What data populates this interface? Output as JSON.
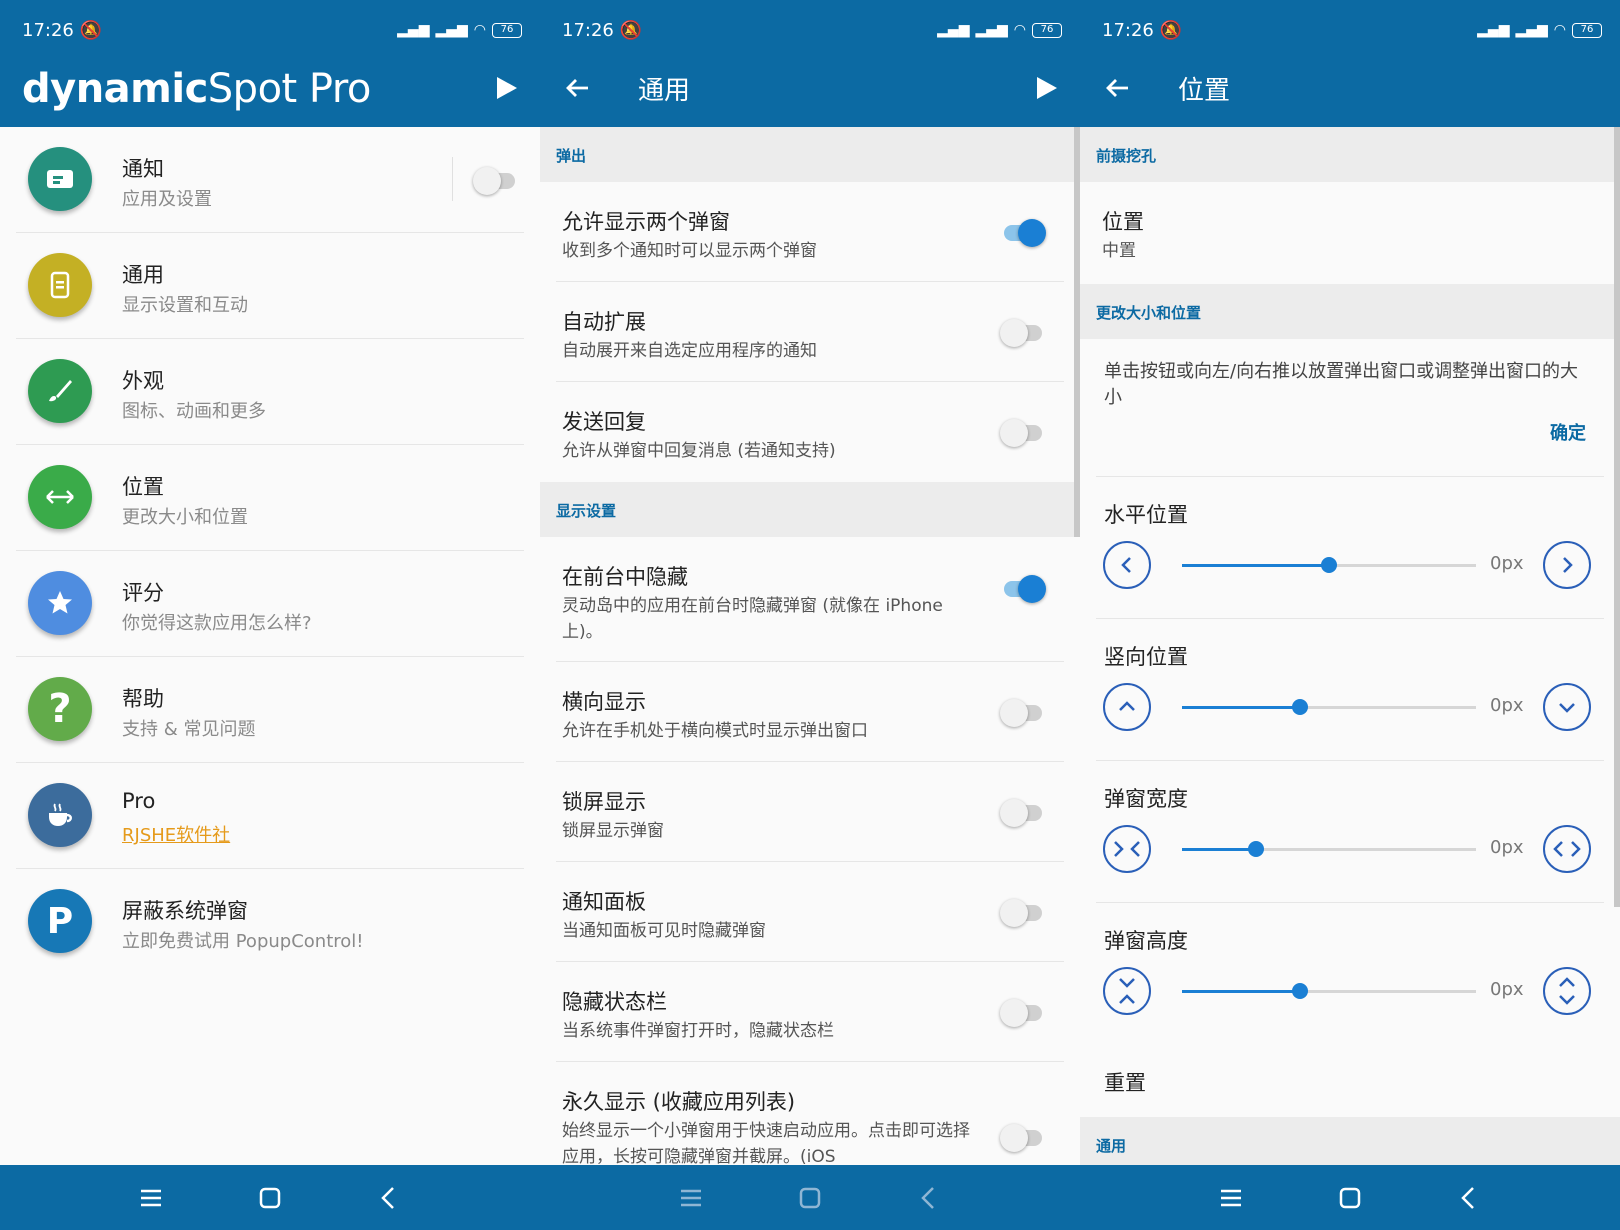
{
  "status": {
    "time": "17:26",
    "battery": "76"
  },
  "screen1": {
    "brand_bold": "dynamic",
    "brand_light": "Spot Pro",
    "items": [
      {
        "title": "通知",
        "subtitle": "应用及设置",
        "color": "#25907e",
        "icon": "notification-icon",
        "toggle": false
      },
      {
        "title": "通用",
        "subtitle": "显示设置和互动",
        "color": "#c4b024",
        "icon": "phone-icon"
      },
      {
        "title": "外观",
        "subtitle": "图标、动画和更多",
        "color": "#2e9b52",
        "icon": "brush-icon"
      },
      {
        "title": "位置",
        "subtitle": "更改大小和位置",
        "color": "#3aab49",
        "icon": "arrows-icon"
      },
      {
        "title": "评分",
        "subtitle": "你觉得这款应用怎么样?",
        "color": "#4f8de0",
        "icon": "star-icon"
      },
      {
        "title": "帮助",
        "subtitle": "支持 & 常见问题",
        "color": "#62ab4a",
        "icon": "help-icon"
      },
      {
        "title": "Pro",
        "subtitle": "RJSHE软件社",
        "color": "#3c6c9c",
        "icon": "coffee-icon"
      },
      {
        "title": "屏蔽系统弹窗",
        "subtitle": "立即免费试用 PopupControl!",
        "color": "#1778b6",
        "icon": "popupcontrol-icon"
      }
    ]
  },
  "screen2": {
    "title": "通用",
    "section1": "弹出",
    "rows1": [
      {
        "title": "允许显示两个弹窗",
        "subtitle": "收到多个通知时可以显示两个弹窗",
        "on": true
      },
      {
        "title": "自动扩展",
        "subtitle": "自动展开来自选定应用程序的通知",
        "on": false
      },
      {
        "title": "发送回复",
        "subtitle": "允许从弹窗中回复消息 (若通知支持)",
        "on": false
      }
    ],
    "section2": "显示设置",
    "rows2": [
      {
        "title": "在前台中隐藏",
        "subtitle": "灵动岛中的应用在前台时隐藏弹窗 (就像在 iPhone 上)。",
        "on": true
      },
      {
        "title": "横向显示",
        "subtitle": "允许在手机处于横向模式时显示弹出窗口",
        "on": false
      },
      {
        "title": "锁屏显示",
        "subtitle": "锁屏显示弹窗",
        "on": false
      },
      {
        "title": "通知面板",
        "subtitle": "当通知面板可见时隐藏弹窗",
        "on": false
      },
      {
        "title": "隐藏状态栏",
        "subtitle": "当系统事件弹窗打开时，隐藏状态栏",
        "on": false
      },
      {
        "title": "永久显示 (收藏应用列表)",
        "subtitle": "始终显示一个小弹窗用于快速启动应用。点击即可选择应用，长按可隐藏弹窗并截屏。(iOS",
        "on": false
      }
    ]
  },
  "screen3": {
    "title": "位置",
    "section1": "前摄挖孔",
    "position_label": "位置",
    "position_value": "中置",
    "section2": "更改大小和位置",
    "instructions": "单击按钮或向左/向右推以放置弹出窗口或调整弹出窗口的大小",
    "confirm": "确定",
    "sliders": [
      {
        "label": "水平位置",
        "value": "0px",
        "fraction": 0.5,
        "left_icon": "chevron-left-icon",
        "right_icon": "chevron-right-icon"
      },
      {
        "label": "竖向位置",
        "value": "0px",
        "fraction": 0.4,
        "left_icon": "chevron-up-icon",
        "right_icon": "chevron-down-icon"
      },
      {
        "label": "弹窗宽度",
        "value": "0px",
        "fraction": 0.25,
        "left_icon": "shrink-width-icon",
        "right_icon": "expand-width-icon"
      },
      {
        "label": "弹窗高度",
        "value": "0px",
        "fraction": 0.4,
        "left_icon": "shrink-height-icon",
        "right_icon": "expand-height-icon"
      }
    ],
    "reset": "重置",
    "section3": "通用"
  },
  "colors": {
    "primary": "#0c6aa3",
    "accent": "#1a7fd4",
    "link": "#e59a1a"
  }
}
